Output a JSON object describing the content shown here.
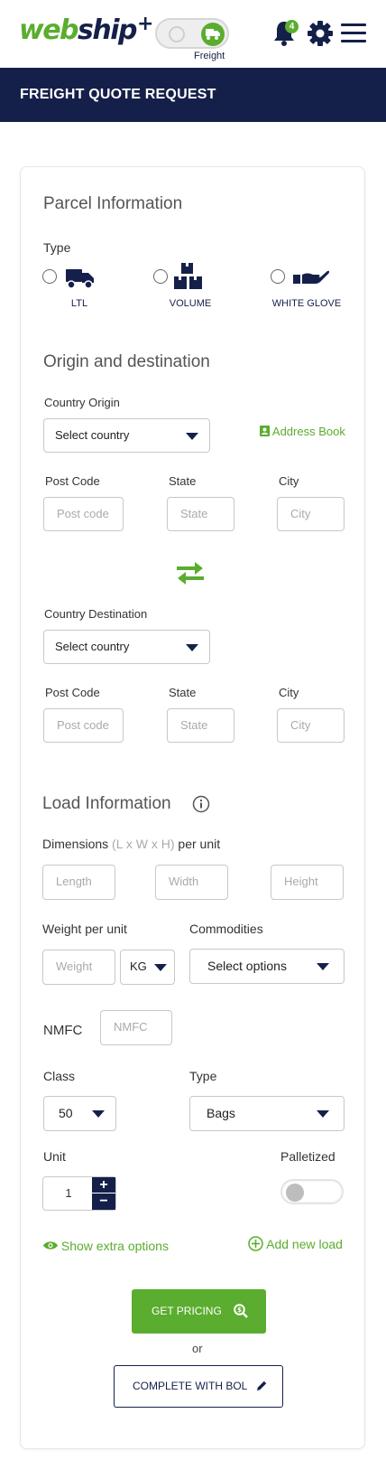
{
  "header": {
    "logo_main": "webship",
    "logo_plus": "+",
    "mode_toggle_label": "Freight",
    "notification_count": "4"
  },
  "page_title": "FREIGHT QUOTE REQUEST",
  "parcel": {
    "title": "Parcel Information",
    "type_label": "Type",
    "types": [
      "LTL",
      "VOLUME",
      "WHITE GLOVE"
    ]
  },
  "origin_destination": {
    "title": "Origin and destination",
    "country_origin_label": "Country Origin",
    "country_origin_value": "Select country",
    "address_book": "Address Book",
    "post_code_label": "Post Code",
    "state_label": "State",
    "city_label": "City",
    "post_code_placeholder": "Post code",
    "state_placeholder": "State",
    "city_placeholder": "City",
    "country_destination_label": "Country Destination",
    "country_destination_value": "Select country"
  },
  "load": {
    "title": "Load Information",
    "dimensions_label": "Dimensions",
    "dimensions_hint": "(L x W x H)",
    "dimensions_suffix": "per unit",
    "length_placeholder": "Length",
    "width_placeholder": "Width",
    "height_placeholder": "Height",
    "weight_label": "Weight per unit",
    "weight_placeholder": "Weight",
    "weight_unit": "KG",
    "commodities_label": "Commodities",
    "commodities_value": "Select options",
    "nmfc_label": "NMFC",
    "nmfc_placeholder": "NMFC",
    "class_label": "Class",
    "class_value": "50",
    "type_label": "Type",
    "type_value": "Bags",
    "unit_label": "Unit",
    "unit_value": "1",
    "palletized_label": "Palletized",
    "show_extra": "Show extra options",
    "add_load": "Add new load"
  },
  "actions": {
    "get_pricing": "GET PRICING",
    "or": "or",
    "complete_bol": "COMPLETE WITH BOL"
  },
  "colors": {
    "navy": "#15204a",
    "green": "#5aad2e"
  }
}
